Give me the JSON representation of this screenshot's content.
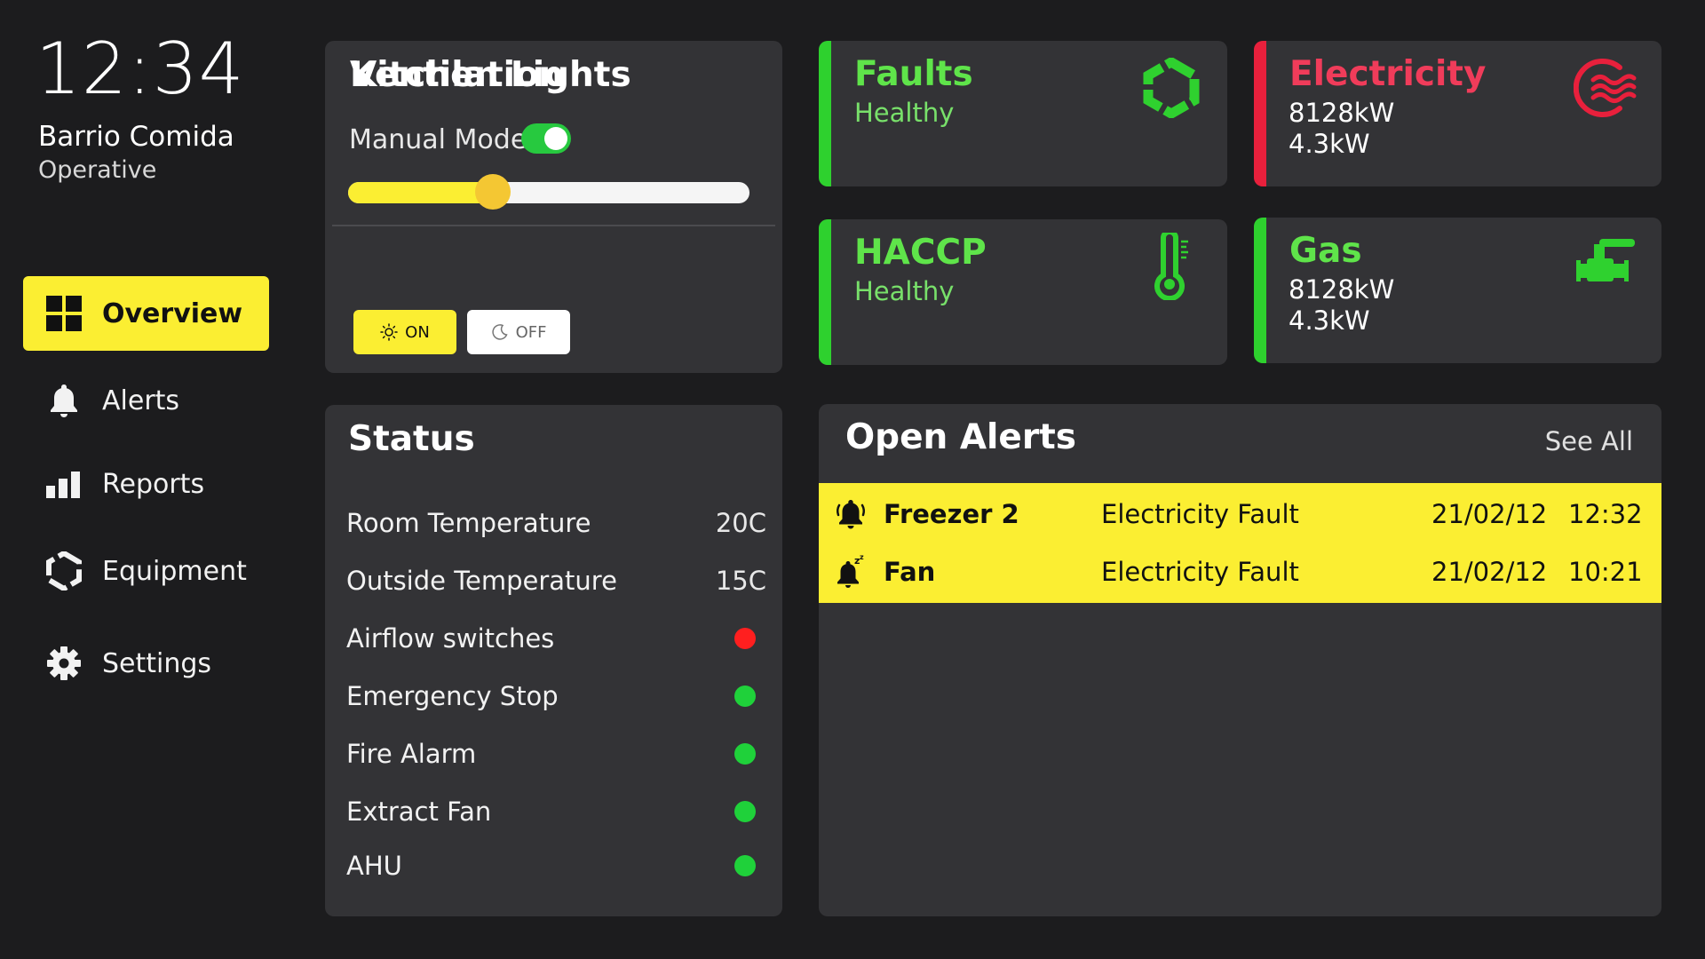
{
  "header": {
    "time": "12:34",
    "site_name": "Barrio Comida",
    "site_status": "Operative"
  },
  "nav": {
    "items": [
      {
        "label": "Overview",
        "icon": "overview-grid-icon",
        "active": true
      },
      {
        "label": "Alerts",
        "icon": "bell-icon"
      },
      {
        "label": "Reports",
        "icon": "bar-chart-icon"
      },
      {
        "label": "Equipment",
        "icon": "equipment-hexagon-icon"
      },
      {
        "label": "Settings",
        "icon": "gear-icon"
      }
    ]
  },
  "ventilation": {
    "title": "Ventilation",
    "manual_mode_label": "Manual Mode",
    "manual_mode_on": true,
    "level_percent": 36
  },
  "kitchen_lights": {
    "title": "Kitchen Lights",
    "on_label": "ON",
    "off_label": "OFF",
    "state": "on"
  },
  "tiles": {
    "faults": {
      "title": "Faults",
      "status": "Healthy",
      "icon": "hexagon-fault-icon"
    },
    "electricity": {
      "title": "Electricity",
      "value1": "8128kW",
      "value2": "4.3kW",
      "icon": "electricity-waves-icon"
    },
    "haccp": {
      "title": "HACCP",
      "status": "Healthy",
      "icon": "thermometer-icon"
    },
    "gas": {
      "title": "Gas",
      "value1": "8128kW",
      "value2": "4.3kW",
      "icon": "gas-valve-icon"
    }
  },
  "status": {
    "title": "Status",
    "rows": [
      {
        "label": "Room Temperature",
        "value": "20C"
      },
      {
        "label": "Outside Temperature",
        "value": "15C"
      },
      {
        "label": "Airflow switches",
        "indicator": "red"
      },
      {
        "label": "Emergency Stop",
        "indicator": "green"
      },
      {
        "label": "Fire Alarm",
        "indicator": "green"
      },
      {
        "label": "Extract Fan",
        "indicator": "green"
      },
      {
        "label": "AHU",
        "indicator": "green"
      }
    ]
  },
  "open_alerts": {
    "title": "Open Alerts",
    "see_all": "See All",
    "items": [
      {
        "name": "Freezer 2",
        "type": "Electricity Fault",
        "date": "21/02/12",
        "time": "12:32",
        "icon": "bell-ringing-icon"
      },
      {
        "name": "Fan",
        "type": "Electricity Fault",
        "date": "21/02/12",
        "time": "10:21",
        "icon": "bell-snooze-icon"
      }
    ]
  },
  "colors": {
    "background": "#1c1c1e",
    "card": "#333336",
    "accent_yellow": "#fbee32",
    "healthy_green": "#5fe44a",
    "alert_red": "#f03c5a",
    "dot_red": "#ff1f1f",
    "dot_green": "#1fd13a"
  }
}
